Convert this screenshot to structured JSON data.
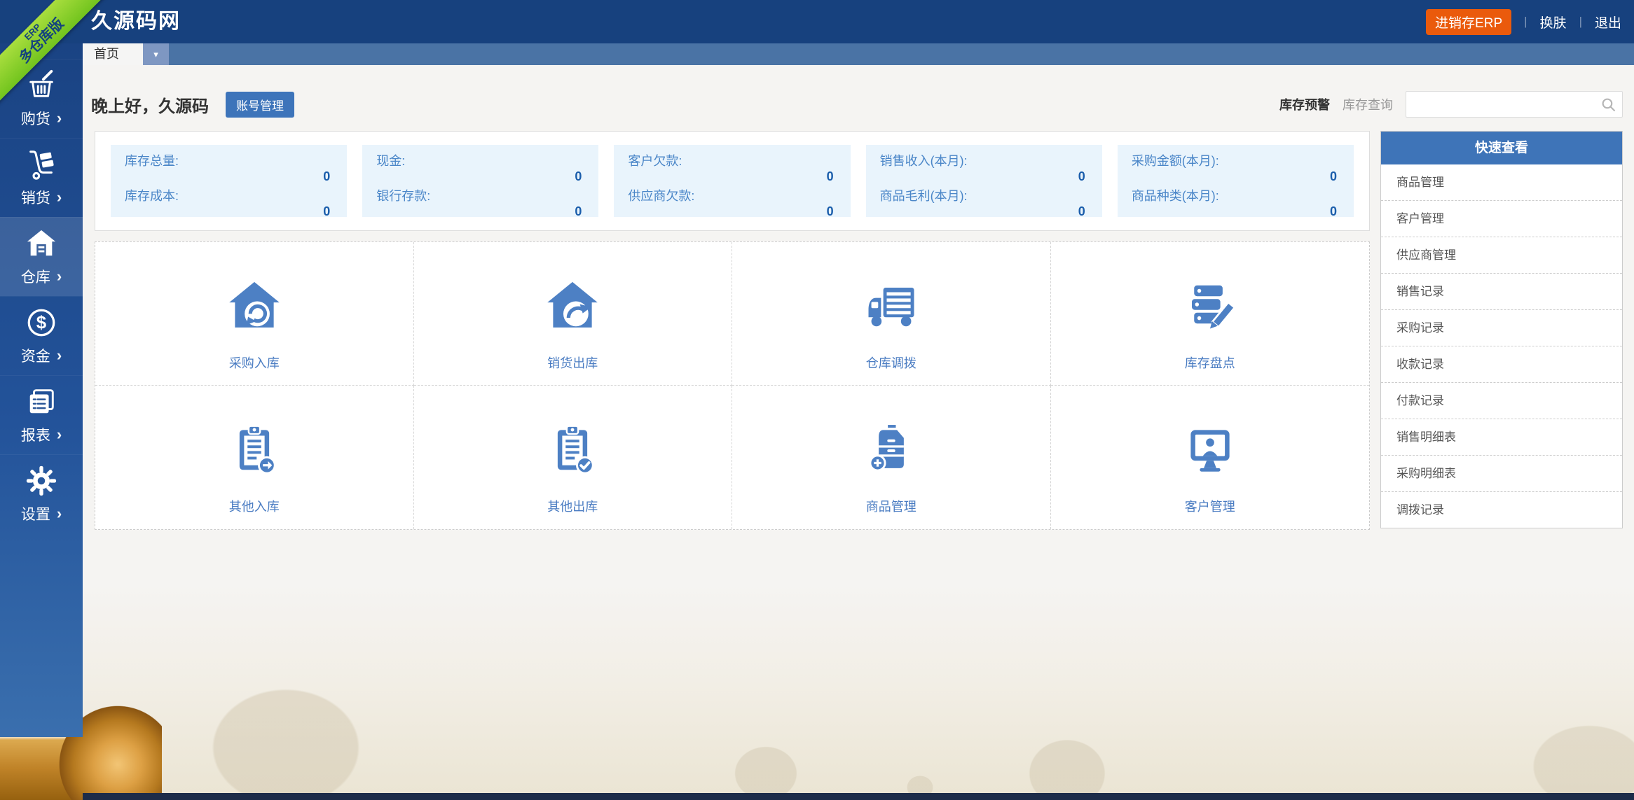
{
  "ribbon": {
    "line1": "ERP",
    "line2": "多仓库版"
  },
  "header": {
    "title": "久源码网",
    "erp_badge": "进销存ERP",
    "change_skin": "换肤",
    "logout": "退出",
    "divider": "|"
  },
  "tabs": {
    "home": "首页",
    "dropdown_icon": "▾"
  },
  "sidebar": {
    "chevron": "›",
    "items": [
      {
        "label": "购货",
        "icon": "basket-icon"
      },
      {
        "label": "销货",
        "icon": "trolley-icon"
      },
      {
        "label": "仓库",
        "icon": "warehouse-icon"
      },
      {
        "label": "资金",
        "icon": "dollar-circle-icon"
      },
      {
        "label": "报表",
        "icon": "report-icon"
      },
      {
        "label": "设置",
        "icon": "gear-icon"
      }
    ]
  },
  "greeting": {
    "text": "晚上好，久源码",
    "badge": "账号管理"
  },
  "inventory_bar": {
    "warning": "库存预警",
    "query": "库存查询",
    "search_placeholder": "",
    "search_icon": "search-icon"
  },
  "stats": {
    "cards": [
      {
        "rows": [
          {
            "label": "库存总量:",
            "value": "0"
          },
          {
            "label": "库存成本:",
            "value": "0"
          }
        ]
      },
      {
        "rows": [
          {
            "label": "现金:",
            "value": "0"
          },
          {
            "label": "银行存款:",
            "value": "0"
          }
        ]
      },
      {
        "rows": [
          {
            "label": "客户欠款:",
            "value": "0"
          },
          {
            "label": "供应商欠款:",
            "value": "0"
          }
        ]
      },
      {
        "rows": [
          {
            "label": "销售收入(本月):",
            "value": "0"
          },
          {
            "label": "商品毛利(本月):",
            "value": "0"
          }
        ]
      },
      {
        "rows": [
          {
            "label": "采购金额(本月):",
            "value": "0"
          },
          {
            "label": "商品种类(本月):",
            "value": "0"
          }
        ]
      }
    ]
  },
  "shortcuts": [
    {
      "label": "采购入库",
      "icon": "house-arrow-in-icon"
    },
    {
      "label": "销货出库",
      "icon": "house-arrow-out-icon"
    },
    {
      "label": "仓库调拨",
      "icon": "truck-icon"
    },
    {
      "label": "库存盘点",
      "icon": "stack-pencil-icon"
    },
    {
      "label": "其他入库",
      "icon": "clipboard-arrow-icon"
    },
    {
      "label": "其他出库",
      "icon": "clipboard-check-icon"
    },
    {
      "label": "商品管理",
      "icon": "cabinet-plus-icon"
    },
    {
      "label": "客户管理",
      "icon": "monitor-user-icon"
    }
  ],
  "quick_view": {
    "title": "快速查看",
    "items": [
      "商品管理",
      "客户管理",
      "供应商管理",
      "销售记录",
      "采购记录",
      "收款记录",
      "付款记录",
      "销售明细表",
      "采购明细表",
      "调拨记录"
    ]
  },
  "colors": {
    "header_blue": "#17417e",
    "tabbar_blue": "#4a73a5",
    "accent_orange": "#ea5a0c",
    "card_bg_blue": "#e9f4fc",
    "stat_label_blue": "#4a86c8",
    "stat_value_blue": "#1a5dab",
    "link_blue": "#4a7cc2",
    "quick_header_blue": "#3e74b8",
    "ribbon_green": "#8cd42a"
  }
}
